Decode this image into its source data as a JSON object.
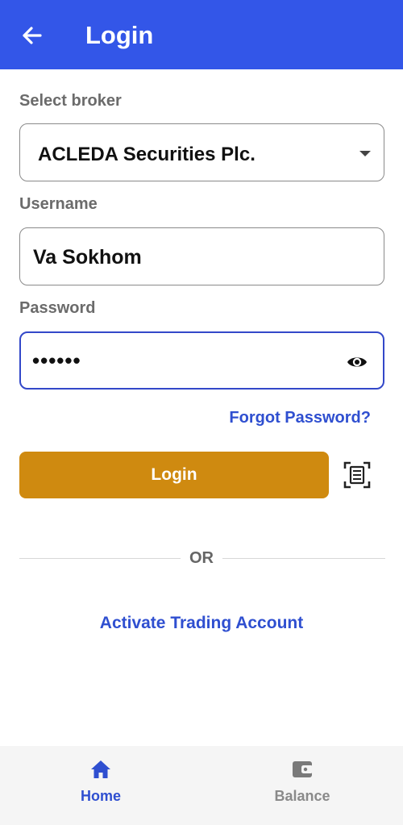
{
  "colors": {
    "app_bar": "#3356e8",
    "accent_link": "#2f4fd0",
    "login_button": "#cf8a10",
    "focused_border": "#3348c9",
    "nav_inactive": "#8a8a8a"
  },
  "header": {
    "title": "Login",
    "back_icon": "arrow-left-icon"
  },
  "form": {
    "broker_label": "Select broker",
    "broker_value": "ACLEDA Securities Plc.",
    "username_label": "Username",
    "username_value": "Va Sokhom",
    "password_label": "Password",
    "password_value": "••••••",
    "eye_icon": "eye-icon",
    "forgot_password": "Forgot Password?",
    "login_label": "Login",
    "scan_icon": "document-scan-icon"
  },
  "divider": {
    "or_text": "OR"
  },
  "activate_link": "Activate Trading Account",
  "bottom_nav": {
    "items": [
      {
        "label": "Home",
        "icon": "home-icon",
        "active": true
      },
      {
        "label": "Balance",
        "icon": "wallet-icon",
        "active": false
      }
    ]
  }
}
